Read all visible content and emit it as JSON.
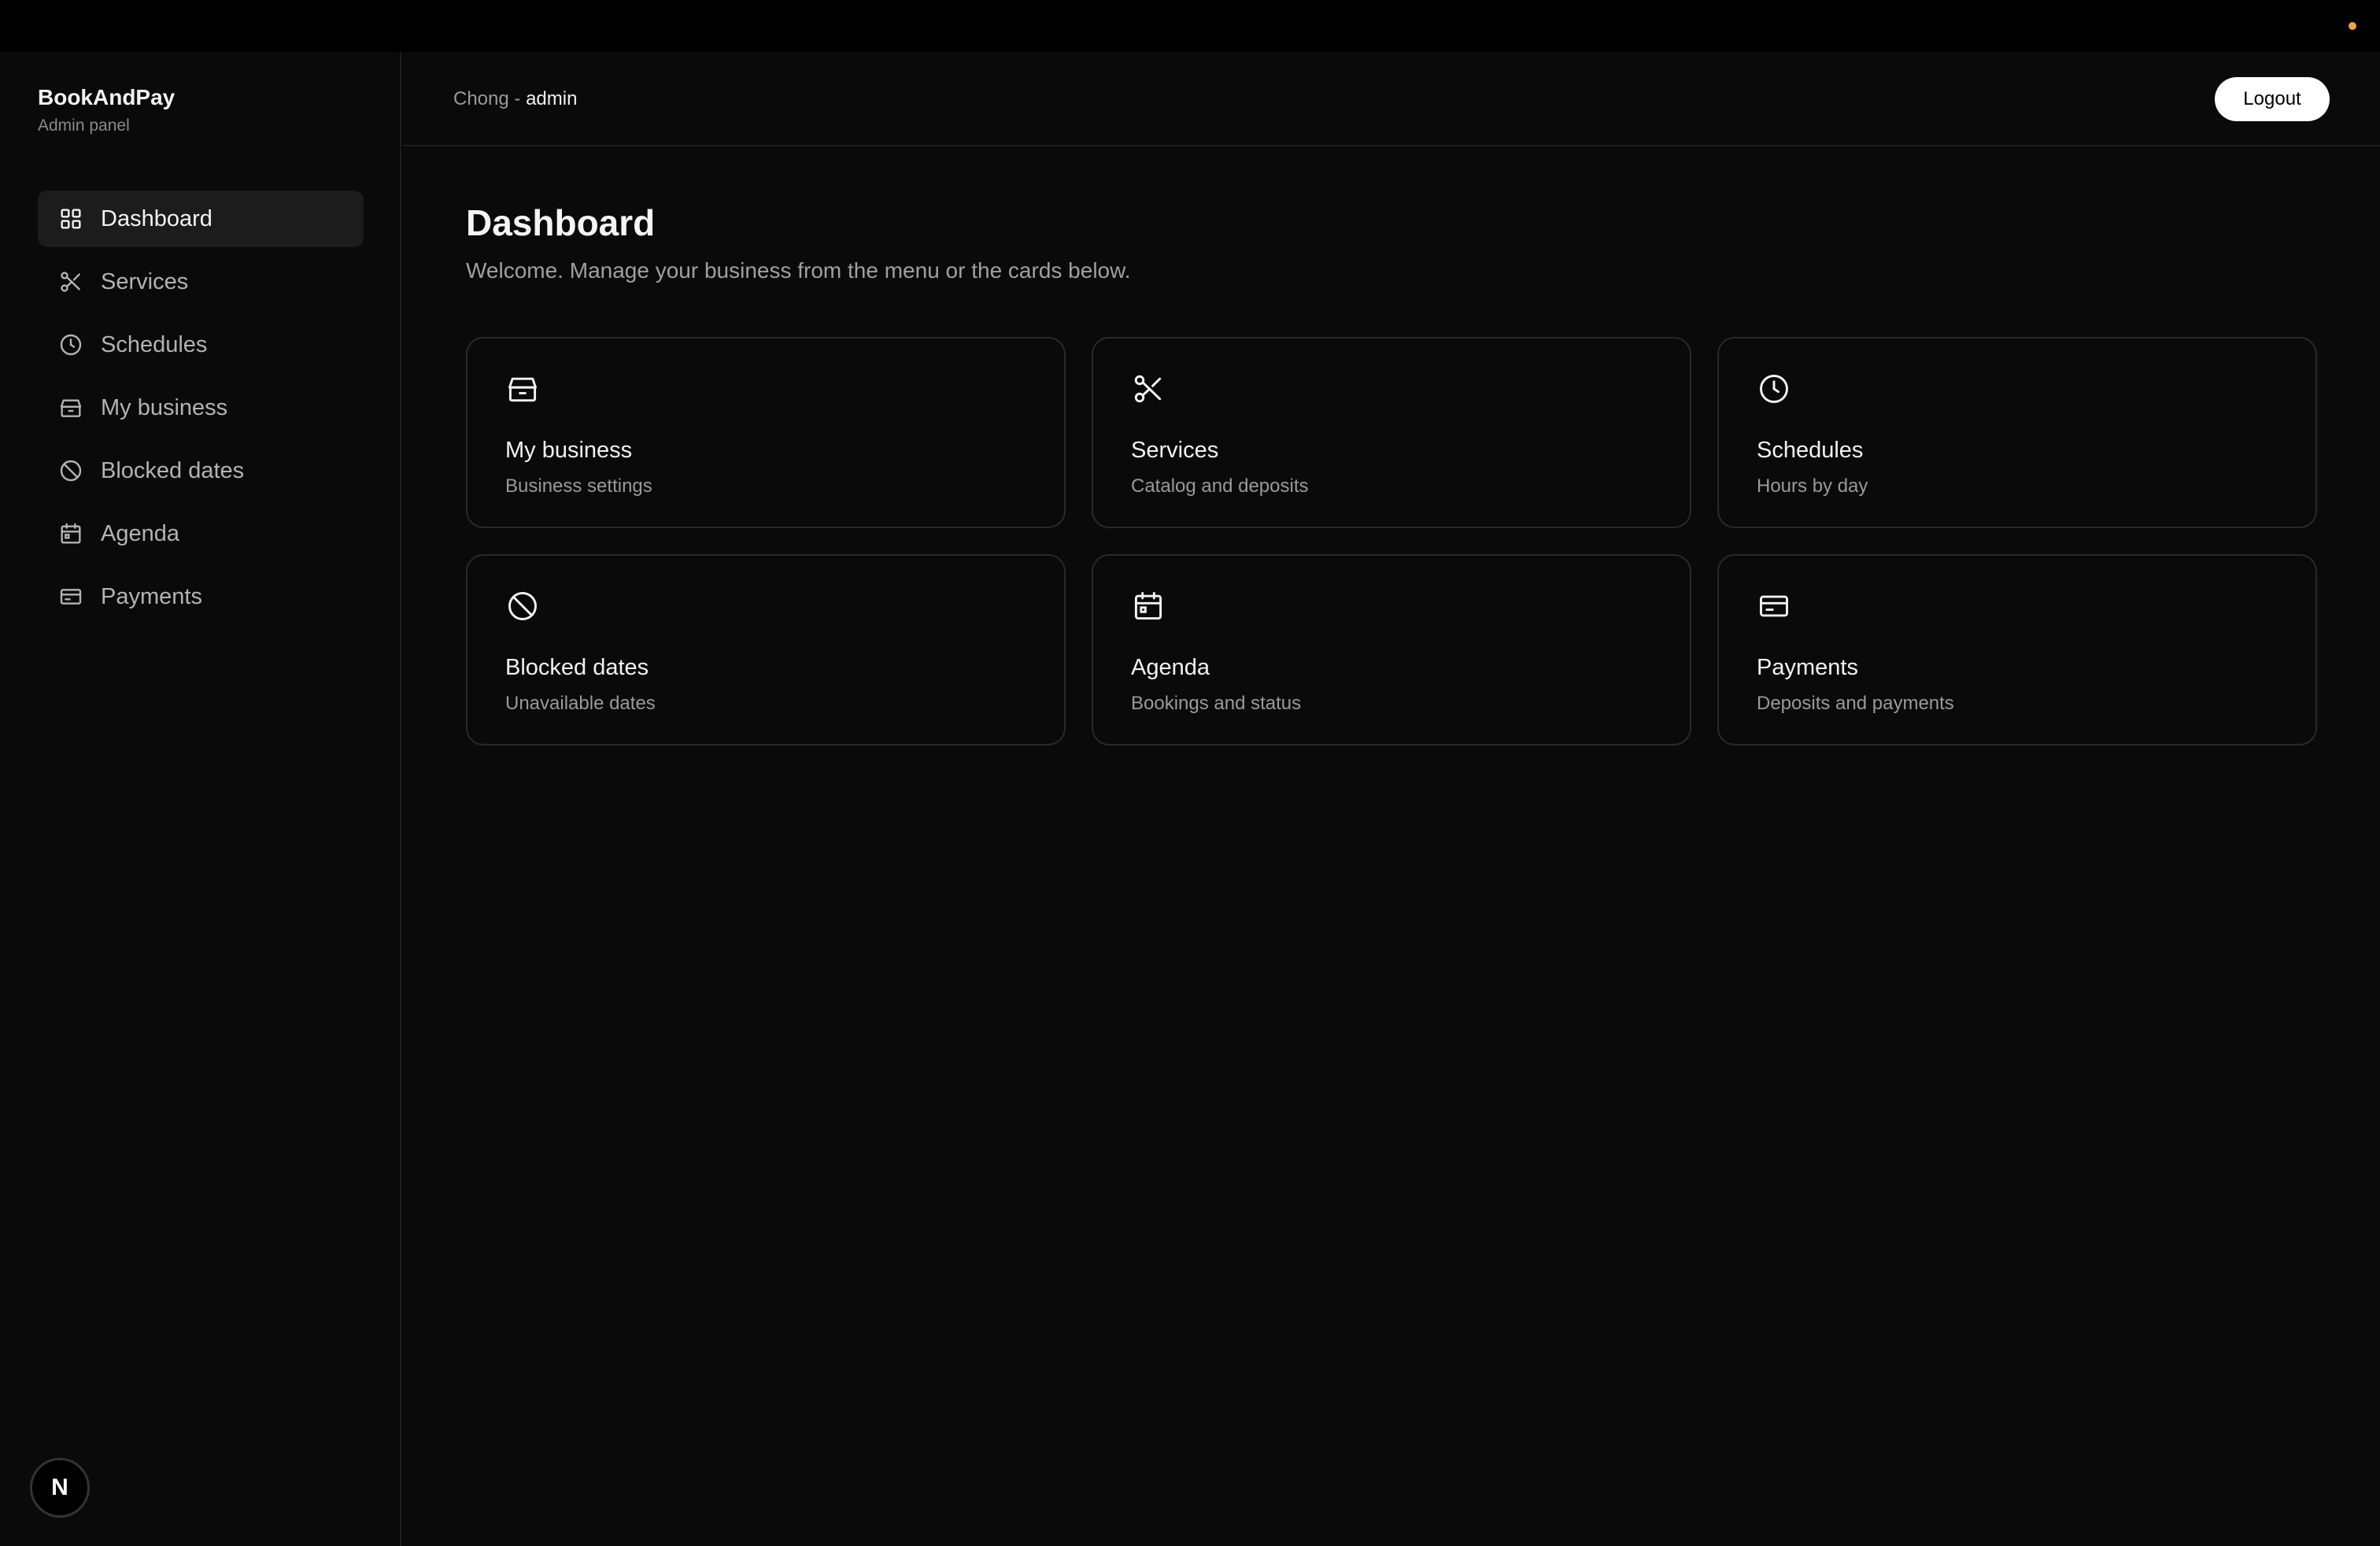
{
  "brand": {
    "name": "BookAndPay",
    "subtitle": "Admin panel"
  },
  "nav": {
    "items": [
      {
        "label": "Dashboard",
        "icon": "dashboard-grid-icon",
        "active": true
      },
      {
        "label": "Services",
        "icon": "scissors-icon"
      },
      {
        "label": "Schedules",
        "icon": "clock-icon"
      },
      {
        "label": "My business",
        "icon": "store-icon"
      },
      {
        "label": "Blocked dates",
        "icon": "ban-icon"
      },
      {
        "label": "Agenda",
        "icon": "calendar-icon"
      },
      {
        "label": "Payments",
        "icon": "credit-card-icon"
      }
    ]
  },
  "header": {
    "user_name": "Chong",
    "separator": " - ",
    "user_role": "admin",
    "logout_label": "Logout"
  },
  "main": {
    "title": "Dashboard",
    "subtitle": "Welcome. Manage your business from the menu or the cards below."
  },
  "cards": [
    {
      "title": "My business",
      "desc": "Business settings",
      "icon": "store-icon"
    },
    {
      "title": "Services",
      "desc": "Catalog and deposits",
      "icon": "scissors-icon"
    },
    {
      "title": "Schedules",
      "desc": "Hours by day",
      "icon": "clock-icon"
    },
    {
      "title": "Blocked dates",
      "desc": "Unavailable dates",
      "icon": "ban-icon"
    },
    {
      "title": "Agenda",
      "desc": "Bookings and status",
      "icon": "calendar-icon"
    },
    {
      "title": "Payments",
      "desc": "Deposits and payments",
      "icon": "credit-card-icon"
    }
  ],
  "dev_badge": {
    "letter": "N"
  },
  "colors": {
    "background": "#0a0a0a",
    "accent_dot": "#f5a340",
    "active_nav": "#1c1c1c"
  }
}
